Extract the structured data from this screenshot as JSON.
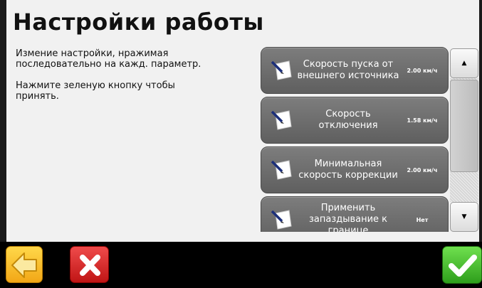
{
  "title": "Настройки работы",
  "instructions": [
    "Измение настройки, нражимая\nпоследовательно на кажд. параметр.",
    "Нажмите зеленую кнопку чтобы\nпринять."
  ],
  "params": [
    {
      "label": "Скорость пуска от внешнего источника",
      "value": "2.00 км/ч",
      "icon": "edit-note-icon"
    },
    {
      "label": "Скорость отключения",
      "value": "1.58 км/ч",
      "icon": "edit-note-icon"
    },
    {
      "label": "Минимальная скорость коррекции",
      "value": "2.00 км/ч",
      "icon": "edit-note-icon"
    },
    {
      "label": "Применить запаздывание к границе",
      "value": "Нет",
      "icon": "edit-note-icon"
    }
  ],
  "scroll": {
    "up_glyph": "▲",
    "down_glyph": "▼",
    "up_icon": "scroll-up-arrow-icon",
    "down_icon": "scroll-down-arrow-icon"
  },
  "actions": {
    "back_icon": "back-arrow-icon",
    "cancel_icon": "cancel-x-icon",
    "accept_icon": "accept-checkmark-icon"
  },
  "colors": {
    "back": "#f5b820",
    "cancel": "#d42020",
    "accept": "#3db52a",
    "card": "#6e6e6e"
  }
}
